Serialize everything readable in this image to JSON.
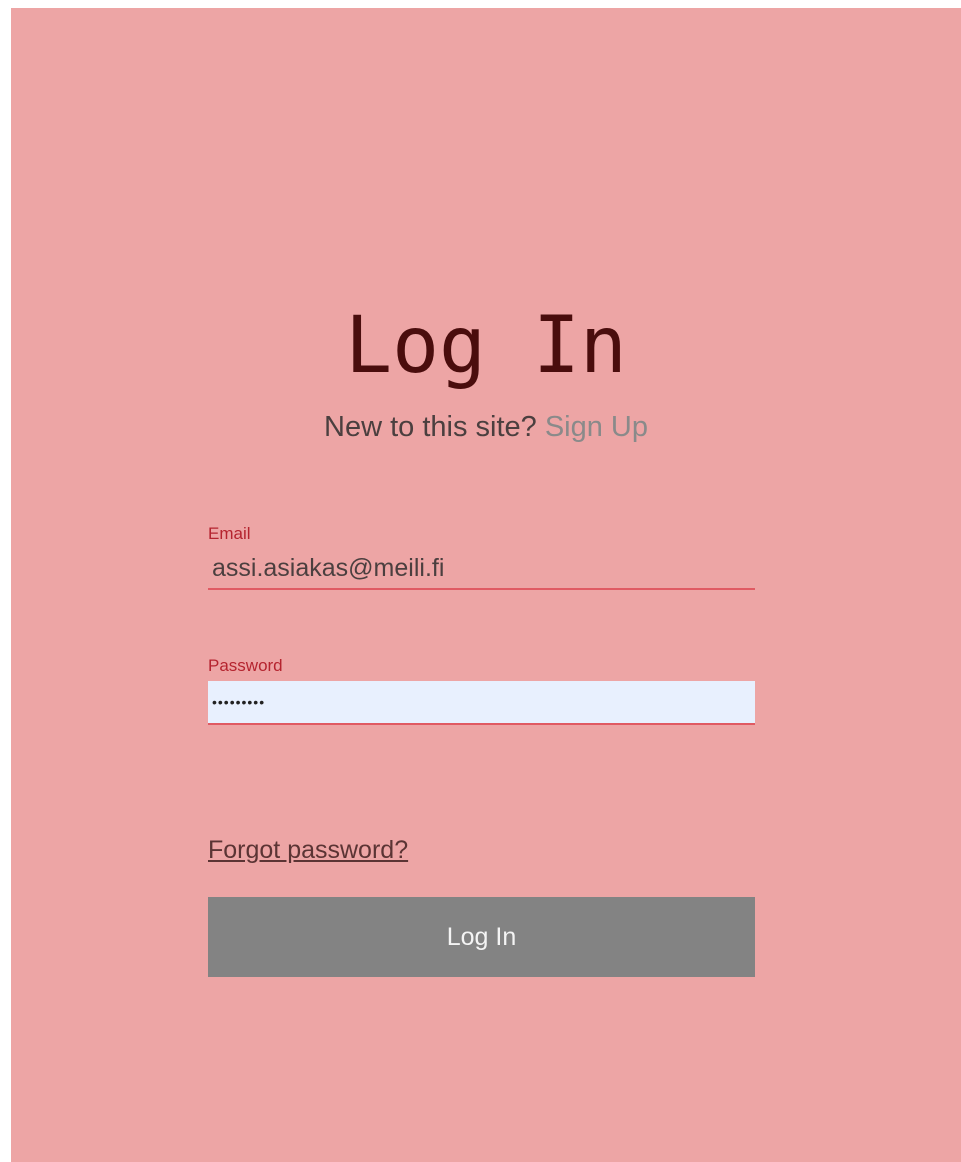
{
  "header": {
    "title": "Log In",
    "signup_prompt": "New to this site?",
    "signup_link": "Sign Up"
  },
  "form": {
    "email": {
      "label": "Email",
      "value": "assi.asiakas@meili.fi"
    },
    "password": {
      "label": "Password",
      "value": "•••••••••"
    },
    "forgot_password": "Forgot password?",
    "submit_label": "Log In"
  },
  "colors": {
    "background": "#eda5a5",
    "title": "#4a0d0d",
    "label": "#b5242f",
    "underline": "#e05a63",
    "button": "#838383",
    "autofill": "#e8f0fe"
  }
}
